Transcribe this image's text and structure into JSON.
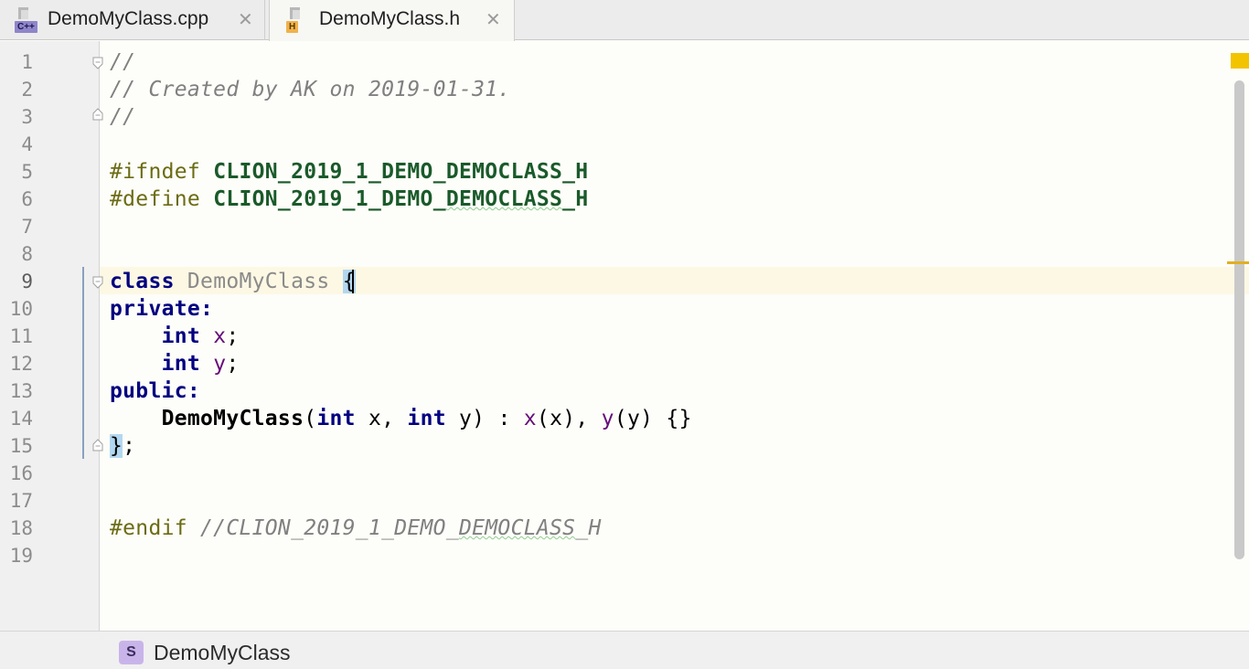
{
  "tabs": [
    {
      "label": "DemoMyClass.cpp",
      "badge": "C++",
      "badge_color": "#7d6fbf",
      "active": false
    },
    {
      "label": "DemoMyClass.h",
      "badge": "H",
      "badge_color": "#e8a53a",
      "active": true
    }
  ],
  "tab_close_glyph": "✕",
  "line_numbers": [
    "1",
    "2",
    "3",
    "4",
    "5",
    "6",
    "7",
    "8",
    "9",
    "10",
    "11",
    "12",
    "13",
    "14",
    "15",
    "16",
    "17",
    "18",
    "19"
  ],
  "current_line": 9,
  "code": {
    "l1": "//",
    "l2": "// Created by AK on 2019-01-31.",
    "l3": "//",
    "l5_dir": "#ifndef",
    "l5_macro": "CLION_2019_1_DEMO_DEMOCLASS_H",
    "l6_dir": "#define",
    "l6_macro_a": "CLION_2019_1_DEMO_",
    "l6_macro_b": "DEMOCLASS",
    "l6_macro_c": "_H",
    "l9_kw": "class",
    "l9_name": "DemoMyClass",
    "l9_brace": "{",
    "l10_kw": "private:",
    "l11_type": "int",
    "l11_field": "x",
    "l11_semi": ";",
    "l12_type": "int",
    "l12_field": "y",
    "l12_semi": ";",
    "l13_kw": "public:",
    "l14_ctor": "DemoMyClass",
    "l14_open": "(",
    "l14_int1": "int",
    "l14_p1": " x, ",
    "l14_int2": "int",
    "l14_p2": " y) : ",
    "l14_fx": "x",
    "l14_ax": "(x), ",
    "l14_fy": "y",
    "l14_ay": "(y) {}",
    "l15_brace": "}",
    "l15_semi": ";",
    "l18_dir": "#endif",
    "l18_comment_a": " //CLION_2019_1_DEMO_",
    "l18_comment_b": "DEMOCLASS",
    "l18_comment_c": "_H"
  },
  "structure": {
    "badge": "S",
    "label": "DemoMyClass"
  },
  "colors": {
    "keyword": "#000080",
    "comment": "#808080",
    "macro": "#1a5a2a",
    "field": "#660e7a",
    "warning_marker": "#f2c400"
  }
}
